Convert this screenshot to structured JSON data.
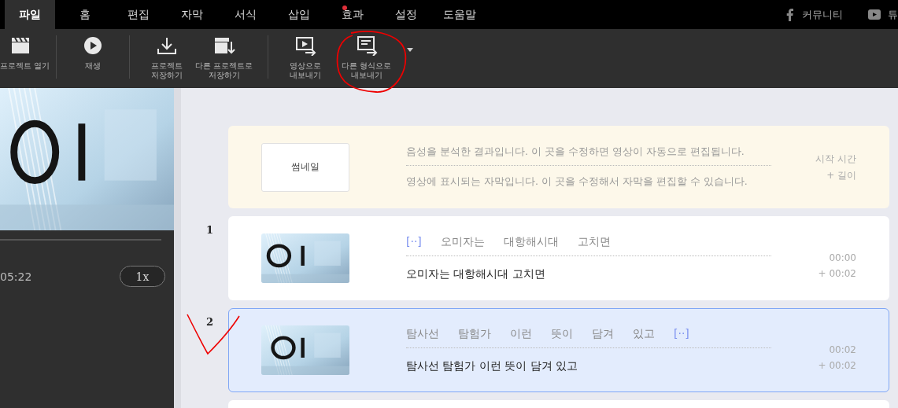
{
  "tabs": [
    {
      "label": "파일",
      "selected": true,
      "badge": false
    },
    {
      "label": "홈",
      "selected": false,
      "badge": false
    },
    {
      "label": "편집",
      "selected": false,
      "badge": false
    },
    {
      "label": "자막",
      "selected": false,
      "badge": false
    },
    {
      "label": "서식",
      "selected": false,
      "badge": false
    },
    {
      "label": "삽입",
      "selected": false,
      "badge": false
    },
    {
      "label": "효과",
      "selected": false,
      "badge": true
    },
    {
      "label": "설정",
      "selected": false,
      "badge": false
    },
    {
      "label": "도움말",
      "selected": false,
      "badge": false
    }
  ],
  "links": [
    {
      "kind": "facebook",
      "label": "커뮤니티"
    },
    {
      "kind": "youtube",
      "label": "튜"
    }
  ],
  "toolbar": [
    [
      {
        "lines": [
          "프로젝트 열기"
        ],
        "dropdown": false
      }
    ],
    [
      {
        "lines": [
          "재생"
        ],
        "dropdown": false
      }
    ],
    [
      {
        "lines": [
          "프로젝트",
          "저장하기"
        ],
        "dropdown": false
      },
      {
        "lines": [
          "다른 프로젝트로",
          "저장하기"
        ],
        "dropdown": false
      }
    ],
    [
      {
        "lines": [
          "영상으로",
          "내보내기"
        ],
        "dropdown": false
      },
      {
        "lines": [
          "다른 형식으로",
          "내보내기"
        ],
        "dropdown": true
      }
    ]
  ],
  "player": {
    "time": "05:22",
    "speed": "1x"
  },
  "header": {
    "thumbnail_label": "썸네일",
    "analysis_hint": "음성을 분석한 결과입니다. 이 곳을 수정하면 영상이 자동으로 편집됩니다.",
    "subtitle_hint": "영상에 표시되는 자막입니다. 이 곳을 수정해서 자막을 편집할 수 있습니다.",
    "start_label": "시작 시간",
    "length_label": "+ 길이"
  },
  "rows": [
    {
      "number": "1",
      "selected": false,
      "words": [
        {
          "kind": "gap",
          "text": "[··]"
        },
        {
          "kind": "word",
          "text": "오미자는"
        },
        {
          "kind": "word",
          "text": "대항해시대"
        },
        {
          "kind": "word",
          "text": "고치면"
        }
      ],
      "subtitle": "오미자는 대항해시대 고치면",
      "start": "00:00",
      "length": "+  00:02"
    },
    {
      "number": "2",
      "selected": true,
      "words": [
        {
          "kind": "word",
          "text": "탐사선"
        },
        {
          "kind": "word",
          "text": "탐험가"
        },
        {
          "kind": "word",
          "text": "이런"
        },
        {
          "kind": "word",
          "text": "뜻이"
        },
        {
          "kind": "word",
          "text": "담겨"
        },
        {
          "kind": "word",
          "text": "있고"
        },
        {
          "kind": "gap",
          "text": "[··]"
        }
      ],
      "subtitle": "탐사선 탐험가 이런 뜻이 담겨 있고",
      "start": "00:02",
      "length": "+  00:02"
    }
  ],
  "next_row_visible": true
}
